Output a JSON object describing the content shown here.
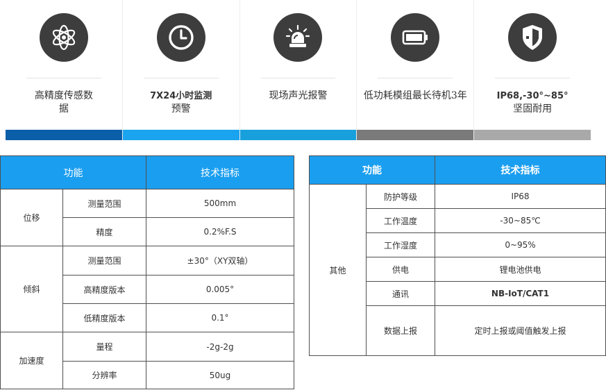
{
  "features": [
    {
      "label_line1": "高精度传感数",
      "label_line2": "据",
      "icon": "atom-icon",
      "strip_color": "#0b5ea8"
    },
    {
      "label_line1": "7X24小时监测",
      "label_line2": "预警",
      "icon": "clock-icon",
      "strip_color": "#1aa3ee"
    },
    {
      "label_line1": "现场声光报警",
      "label_line2": "",
      "icon": "alarm-light-icon",
      "strip_color": "#18a0dd"
    },
    {
      "label_line1": "低功耗模组最长待机3年",
      "label_line2": "",
      "icon": "battery-icon",
      "strip_color": "#7a7a7a"
    },
    {
      "label_line1": "IP68,-30°~85°",
      "label_line2": "坚固耐用",
      "icon": "shield-icon",
      "strip_color": "#a9a9a9"
    }
  ],
  "spec_left": {
    "header_function": "功能",
    "header_spec": "技术指标",
    "groups": [
      {
        "name": "位移",
        "rows": [
          {
            "item": "测量范围",
            "value": "500mm"
          },
          {
            "item": "精度",
            "value": "0.2%F.S"
          }
        ]
      },
      {
        "name": "倾斜",
        "rows": [
          {
            "item": "测量范围",
            "value": "±30°（XY双轴）"
          },
          {
            "item": "高精度版本",
            "value": "0.005°"
          },
          {
            "item": "低精度版本",
            "value": "0.1°"
          }
        ]
      },
      {
        "name": "加速度",
        "rows": [
          {
            "item": "量程",
            "value": "-2g-2g"
          },
          {
            "item": "分辨率",
            "value": "50ug"
          }
        ]
      }
    ]
  },
  "spec_right": {
    "header_function": "功能",
    "header_spec": "技术指标",
    "group_name": "其他",
    "rows": [
      {
        "item": "防护等级",
        "value": "IP68"
      },
      {
        "item": "工作温度",
        "value": "-30~85℃"
      },
      {
        "item": "工作湿度",
        "value": "0~95%"
      },
      {
        "item": "供电",
        "value": "锂电池供电"
      },
      {
        "item": "通讯",
        "value": "NB-IoT/CAT1"
      },
      {
        "item": "数据上报",
        "value": "定时上报或阈值触发上报"
      }
    ]
  }
}
